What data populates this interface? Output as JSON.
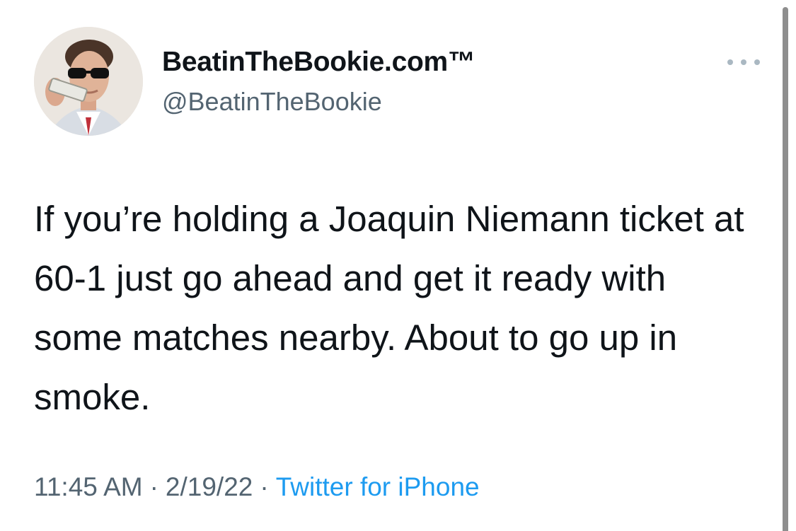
{
  "tweet": {
    "author": {
      "display_name": "BeatinTheBookie.com™",
      "handle": "@BeatinTheBookie",
      "avatar": "avatar-man-sunglasses-phone"
    },
    "more_icon": "more-horizontal-icon",
    "text": "If you’re holding a Joaquin Niemann ticket at 60-1 just go ahead and get it ready with some matches nearby. About to go up in smoke.",
    "time": "11:45 AM",
    "date": "2/19/22",
    "separator": "·",
    "source": "Twitter for iPhone"
  },
  "colors": {
    "text": "#0f1419",
    "secondary": "#536471",
    "link": "#1d9bf0"
  }
}
